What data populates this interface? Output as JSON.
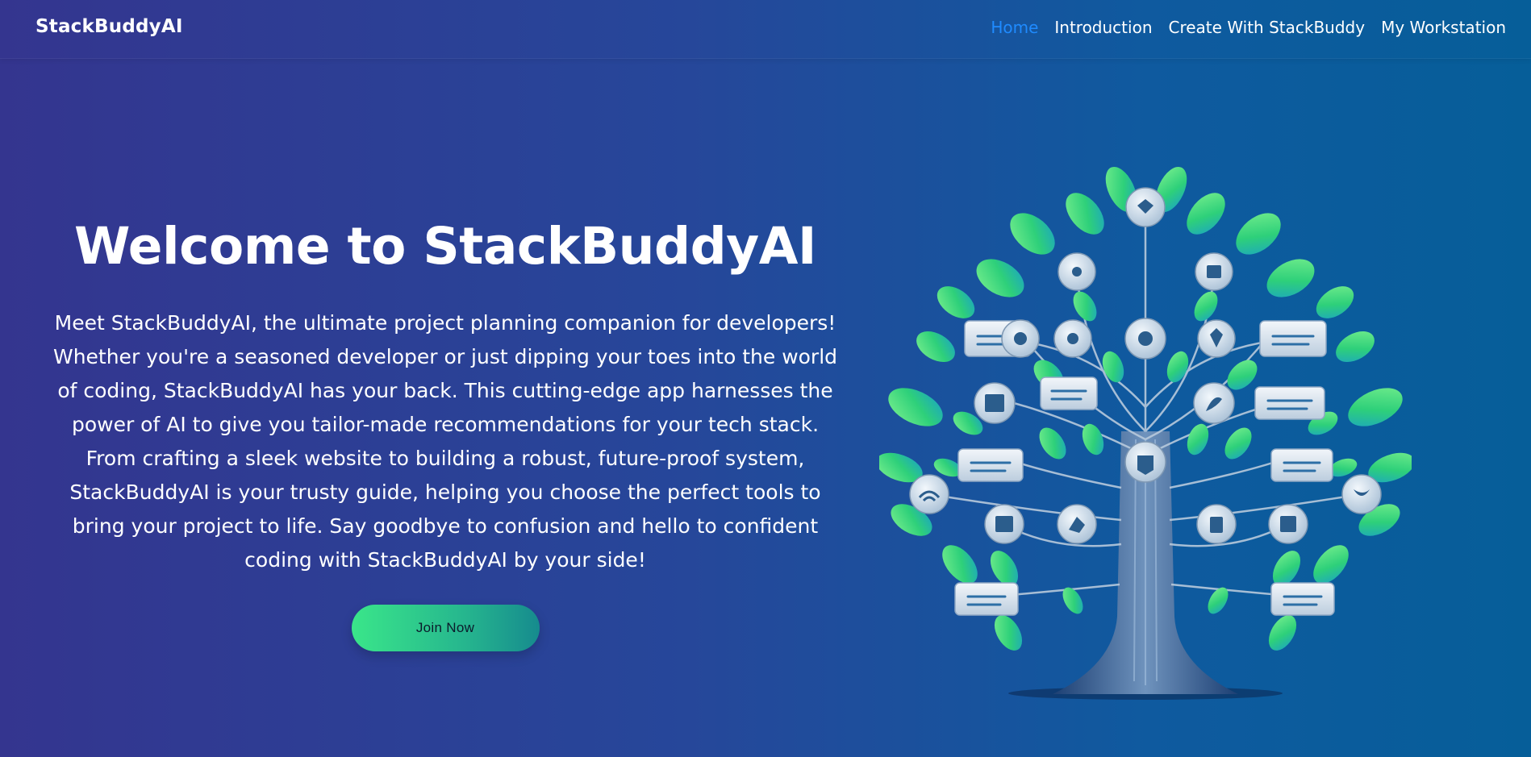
{
  "brand": "StackBuddyAI",
  "nav": {
    "items": [
      {
        "label": "Home",
        "active": true
      },
      {
        "label": "Introduction",
        "active": false
      },
      {
        "label": "Create With StackBuddy",
        "active": false
      },
      {
        "label": "My Workstation",
        "active": false
      }
    ]
  },
  "hero": {
    "title": "Welcome to StackBuddyAI",
    "description": "Meet StackBuddyAI, the ultimate project planning companion for developers! Whether you're a seasoned developer or just dipping your toes into the world of coding, StackBuddyAI has your back. This cutting-edge app harnesses the power of AI to give you tailor-made recommendations for your tech stack. From crafting a sleek website to building a robust, future-proof system, StackBuddyAI is your trusty guide, helping you choose the perfect tools to bring your project to life. Say goodbye to confusion and hello to confident coding with StackBuddyAI by your side!",
    "cta_label": "Join Now"
  },
  "colors": {
    "accent_active_nav": "#1f8bff",
    "button_gradient_start": "#3ae68a",
    "button_gradient_end": "#168b8e"
  }
}
